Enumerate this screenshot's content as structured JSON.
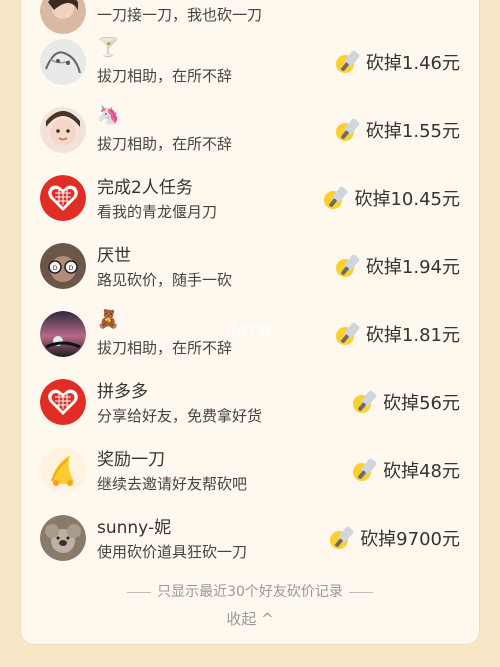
{
  "records": [
    {
      "name": "",
      "desc": "一刀接一刀，我也砍一刀",
      "amount": "",
      "avatar": "girl-face"
    },
    {
      "name": "🍸",
      "desc": "拔刀相助，在所不辞",
      "amount": "砍掉1.46元",
      "avatar": "sketch-face"
    },
    {
      "name": "🦄",
      "desc": "拔刀相助，在所不辞",
      "amount": "砍掉1.55元",
      "avatar": "girl-face"
    },
    {
      "name": "完成2人任务",
      "desc": "看我的青龙偃月刀",
      "amount": "砍掉10.45元",
      "avatar": "pdd-logo"
    },
    {
      "name": "厌世",
      "desc": "路见砍价，随手一砍",
      "amount": "砍掉1.94元",
      "avatar": "glasses-face"
    },
    {
      "name": "🧸",
      "desc": "拔刀相助，在所不辞",
      "amount": "砍掉1.81元",
      "avatar": "sunset-photo"
    },
    {
      "name": "拼多多",
      "desc": "分享给好友，免费拿好货",
      "amount": "砍掉56元",
      "avatar": "pdd-logo"
    },
    {
      "name": "奖励一刀",
      "desc": "继续去邀请好友帮砍吧",
      "amount": "砍掉48元",
      "avatar": "banana-icon"
    },
    {
      "name": "sunny-妮",
      "desc": "使用砍价道具狂砍一刀",
      "amount": "砍掉9700元",
      "avatar": "koala-photo"
    }
  ],
  "footer": {
    "note": "只显示最近30个好友砍价记录",
    "collapse": "收起 ^"
  },
  "watermark": "小红书",
  "colors": {
    "background": "#f8e6c7",
    "card": "#fff8ee",
    "pdd_red": "#e02e24",
    "knife_yellow": "#ffcf2e"
  }
}
